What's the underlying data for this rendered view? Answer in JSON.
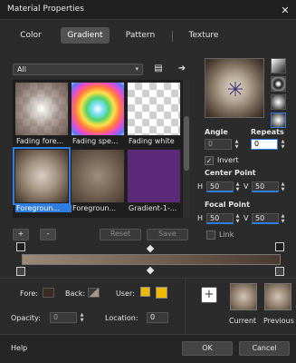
{
  "window": {
    "title": "Material Properties",
    "close_glyph": "✕"
  },
  "tabs": [
    {
      "label": "Color",
      "active": false
    },
    {
      "label": "Gradient",
      "active": true
    },
    {
      "label": "Pattern",
      "active": false
    },
    {
      "label": "Texture",
      "active": false
    }
  ],
  "category": {
    "value": "All",
    "arrow_glyph": "▾"
  },
  "toolbar_icons": {
    "folder_icon": "▤",
    "arrow_icon": "➜"
  },
  "swatches": [
    {
      "label": "Fading fore...",
      "style": "fading-fore"
    },
    {
      "label": "Fading spe...",
      "style": "fading-spectrum"
    },
    {
      "label": "Fading white",
      "style": "fading-white"
    },
    {
      "label": "Foregroun...",
      "style": "fg-bg",
      "selected": true
    },
    {
      "label": "Foregroun...",
      "style": "fg-bg-2"
    },
    {
      "label": "Gradient-1-...",
      "style": "purple"
    }
  ],
  "swatch_buttons": {
    "add": "+",
    "remove": "-",
    "reset": "Reset",
    "save": "Save"
  },
  "angle": {
    "label": "Angle",
    "value": "0"
  },
  "repeats": {
    "label": "Repeats",
    "value": "0"
  },
  "invert": {
    "label": "Invert",
    "checked": true,
    "mark": "✓"
  },
  "center_point": {
    "label": "Center Point",
    "h_label": "H",
    "h_value": "50",
    "v_label": "V",
    "v_value": "50"
  },
  "focal_point": {
    "label": "Focal Point",
    "h_label": "H",
    "h_value": "50",
    "v_label": "V",
    "v_value": "50"
  },
  "link": {
    "label": "Link",
    "checked": false
  },
  "gradient_bar": {
    "start_color": "#9b8a78",
    "end_color": "#4b3a2e"
  },
  "fore": {
    "label": "Fore:"
  },
  "back": {
    "label": "Back:"
  },
  "user": {
    "label": "User:",
    "colors": [
      "#f0b800",
      "#f0b800"
    ]
  },
  "opacity": {
    "label": "Opacity:",
    "value": "0"
  },
  "location": {
    "label": "Location:",
    "value": "0"
  },
  "current": {
    "label": "Current",
    "add_glyph": "+"
  },
  "previous": {
    "label": "Previous"
  },
  "footer": {
    "help": "Help",
    "ok": "OK",
    "cancel": "Cancel"
  },
  "colors": {
    "accent": "#2f7de0",
    "background": "#2b2b2b"
  }
}
